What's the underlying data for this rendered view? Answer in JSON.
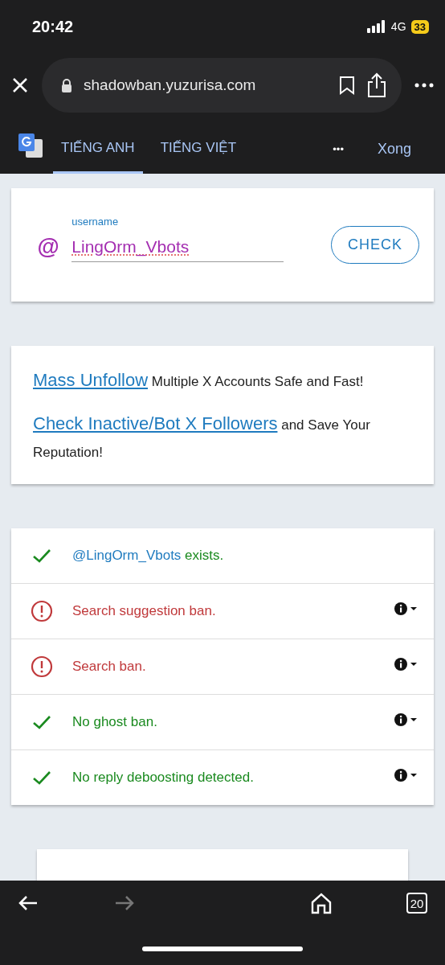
{
  "status_bar": {
    "time": "20:42",
    "network": "4G",
    "battery": "33"
  },
  "browser": {
    "url": "shadowban.yuzurisa.com"
  },
  "translate_bar": {
    "tabs": [
      {
        "label": "TIẾNG ANH",
        "selected": true
      },
      {
        "label": "TIẾNG VIỆT",
        "selected": false
      }
    ],
    "more": "•••",
    "done": "Xong"
  },
  "search_form": {
    "at": "@",
    "label": "username",
    "value": "LingOrm_Vbots",
    "button": "CHECK"
  },
  "promo": {
    "lines": [
      {
        "link": "Mass Unfollow",
        "text": "Multiple X Accounts Safe and Fast!"
      },
      {
        "link": "Check Inactive/Bot X Followers",
        "text": "and Save Your Reputation!"
      }
    ]
  },
  "results": [
    {
      "kind": "ok",
      "user": "@LingOrm_Vbots",
      "text": "exists."
    },
    {
      "kind": "ban",
      "text": "Search suggestion ban.",
      "expanded": false
    },
    {
      "kind": "ban",
      "text": "Search ban.",
      "expanded": false
    },
    {
      "kind": "ok",
      "text": "No ghost ban.",
      "expanded": false
    },
    {
      "kind": "ok",
      "text": "No reply deboosting detected.",
      "expanded": false
    }
  ],
  "bottom_toolbar": {
    "tabs_count": "20"
  }
}
